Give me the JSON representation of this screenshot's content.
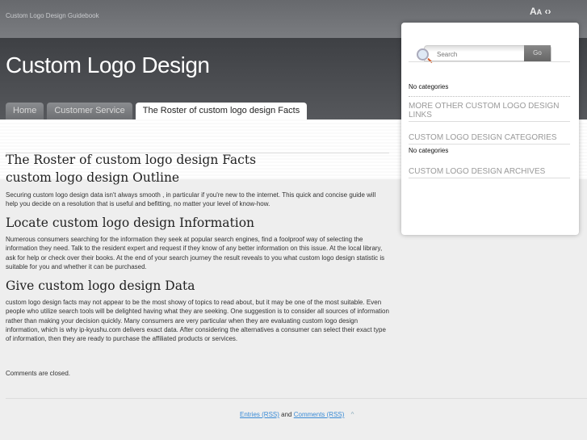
{
  "topbar": {
    "tagline": "Custom Logo Design Guidebook",
    "font_large": "A",
    "font_small": "A",
    "font_arrows": "‹›"
  },
  "header": {
    "title": "Custom Logo Design"
  },
  "tabs": [
    {
      "label": "Home"
    },
    {
      "label": "Customer Service"
    },
    {
      "label": "The Roster of custom logo design Facts",
      "active": true
    }
  ],
  "article": {
    "title": "The Roster of custom logo design Facts",
    "sections": [
      {
        "heading": "custom logo design Outline",
        "body": "Securing custom logo design data isn't always smooth , in particular if you're new to the internet. This quick and concise guide will help you decide on a resolution that is useful and befitting, no matter your level of know-how."
      },
      {
        "heading": "Locate custom logo design Information",
        "body": "Numerous consumers searching for the information they seek at popular search engines, find a foolproof way of selecting the information they need. Talk to the resident expert and request if they know of any better information on this issue. At the local library, ask for help or check over their books. At the end of your search journey the result reveals to you what custom logo design statistic is suitable for you and whether it can be purchased."
      },
      {
        "heading": "Give custom logo design Data",
        "body": "custom logo design facts may not appear to be the most showy of topics to read about, but it may be one of the most suitable. Even people who utilize search tools will be delighted having what they are seeking. One suggestion is to consider all sources of information rather than making your decision quickly. Many consumers are very particular when they are evaluating custom logo design information, which is why ip-kyushu.com delivers exact data. After considering the alternatives a consumer can select their exact type of information, then they are ready to purchase the affiliated products or services."
      }
    ],
    "comments": "Comments are closed."
  },
  "footer": {
    "entries": "Entries (RSS)",
    "and": "and",
    "comments": "Comments (RSS)",
    "up": "^"
  },
  "sidebar": {
    "search_placeholder": "Search",
    "go": "Go",
    "no_categories_1": "No categories",
    "links_title": "MORE OTHER CUSTOM LOGO DESIGN LINKS",
    "categories_title": "CUSTOM LOGO DESIGN CATEGORIES",
    "no_categories_2": "No categories",
    "archives_title": "CUSTOM LOGO DESIGN ARCHIVES"
  }
}
